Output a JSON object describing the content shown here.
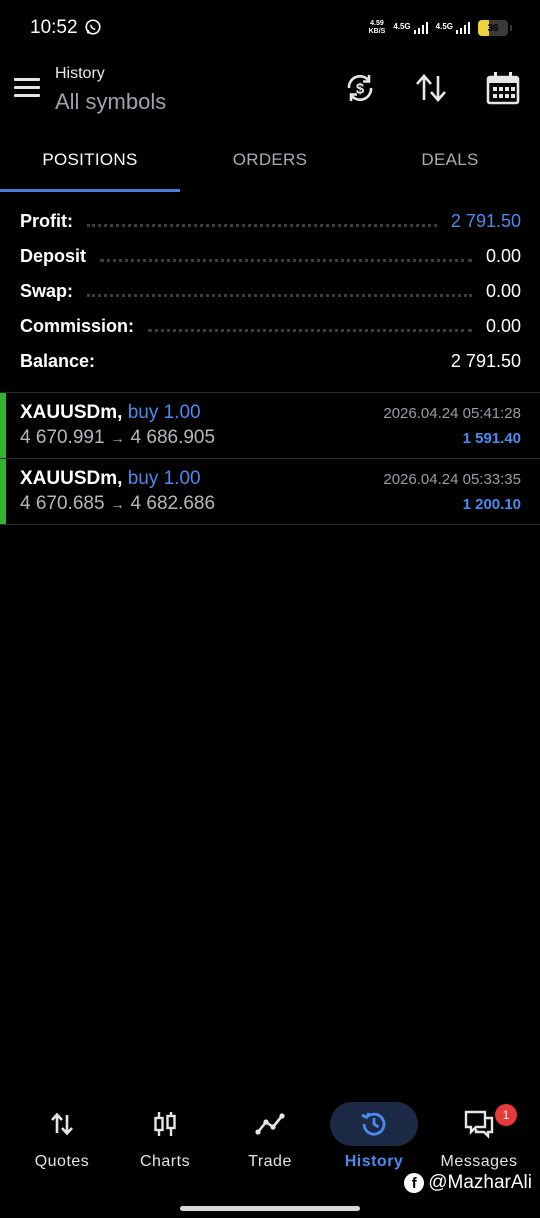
{
  "status_bar": {
    "time": "10:52",
    "net_speed_value": "4.59",
    "net_speed_unit": "KB/S",
    "sim1": "4.5G",
    "sim2": "4.5G",
    "battery": "36"
  },
  "header": {
    "title": "History",
    "subtitle": "All symbols"
  },
  "tabs": [
    {
      "label": "POSITIONS",
      "active": true
    },
    {
      "label": "ORDERS",
      "active": false
    },
    {
      "label": "DEALS",
      "active": false
    }
  ],
  "summary": [
    {
      "label": "Profit:",
      "value": "2 791.50"
    },
    {
      "label": "Deposit",
      "value": "0.00"
    },
    {
      "label": "Swap:",
      "value": "0.00"
    },
    {
      "label": "Commission:",
      "value": "0.00"
    },
    {
      "label": "Balance:",
      "value": "2 791.50"
    }
  ],
  "positions": [
    {
      "symbol": "XAUUSDm,",
      "side": "buy 1.00",
      "open": "4 670.991",
      "arrow": "→",
      "close": "4 686.905",
      "time": "2026.04.24 05:41:28",
      "profit": "1 591.40"
    },
    {
      "symbol": "XAUUSDm,",
      "side": "buy 1.00",
      "open": "4 670.685",
      "arrow": "→",
      "close": "4 682.686",
      "time": "2026.04.24 05:33:35",
      "profit": "1 200.10"
    }
  ],
  "bottom_nav": [
    {
      "label": "Quotes",
      "icon": "quotes-arrows-icon"
    },
    {
      "label": "Charts",
      "icon": "candlestick-icon"
    },
    {
      "label": "Trade",
      "icon": "trade-line-icon"
    },
    {
      "label": "History",
      "icon": "history-clock-icon",
      "active": true
    },
    {
      "label": "Messages",
      "icon": "chat-bubbles-icon",
      "badge": "1"
    }
  ],
  "watermark": "@MazharAli",
  "colors": {
    "accent": "#4a8bf0",
    "tab_underline": "#4a7fe0",
    "buy_bar": "#34b233",
    "badge": "#e5393a",
    "background": "#000000"
  }
}
